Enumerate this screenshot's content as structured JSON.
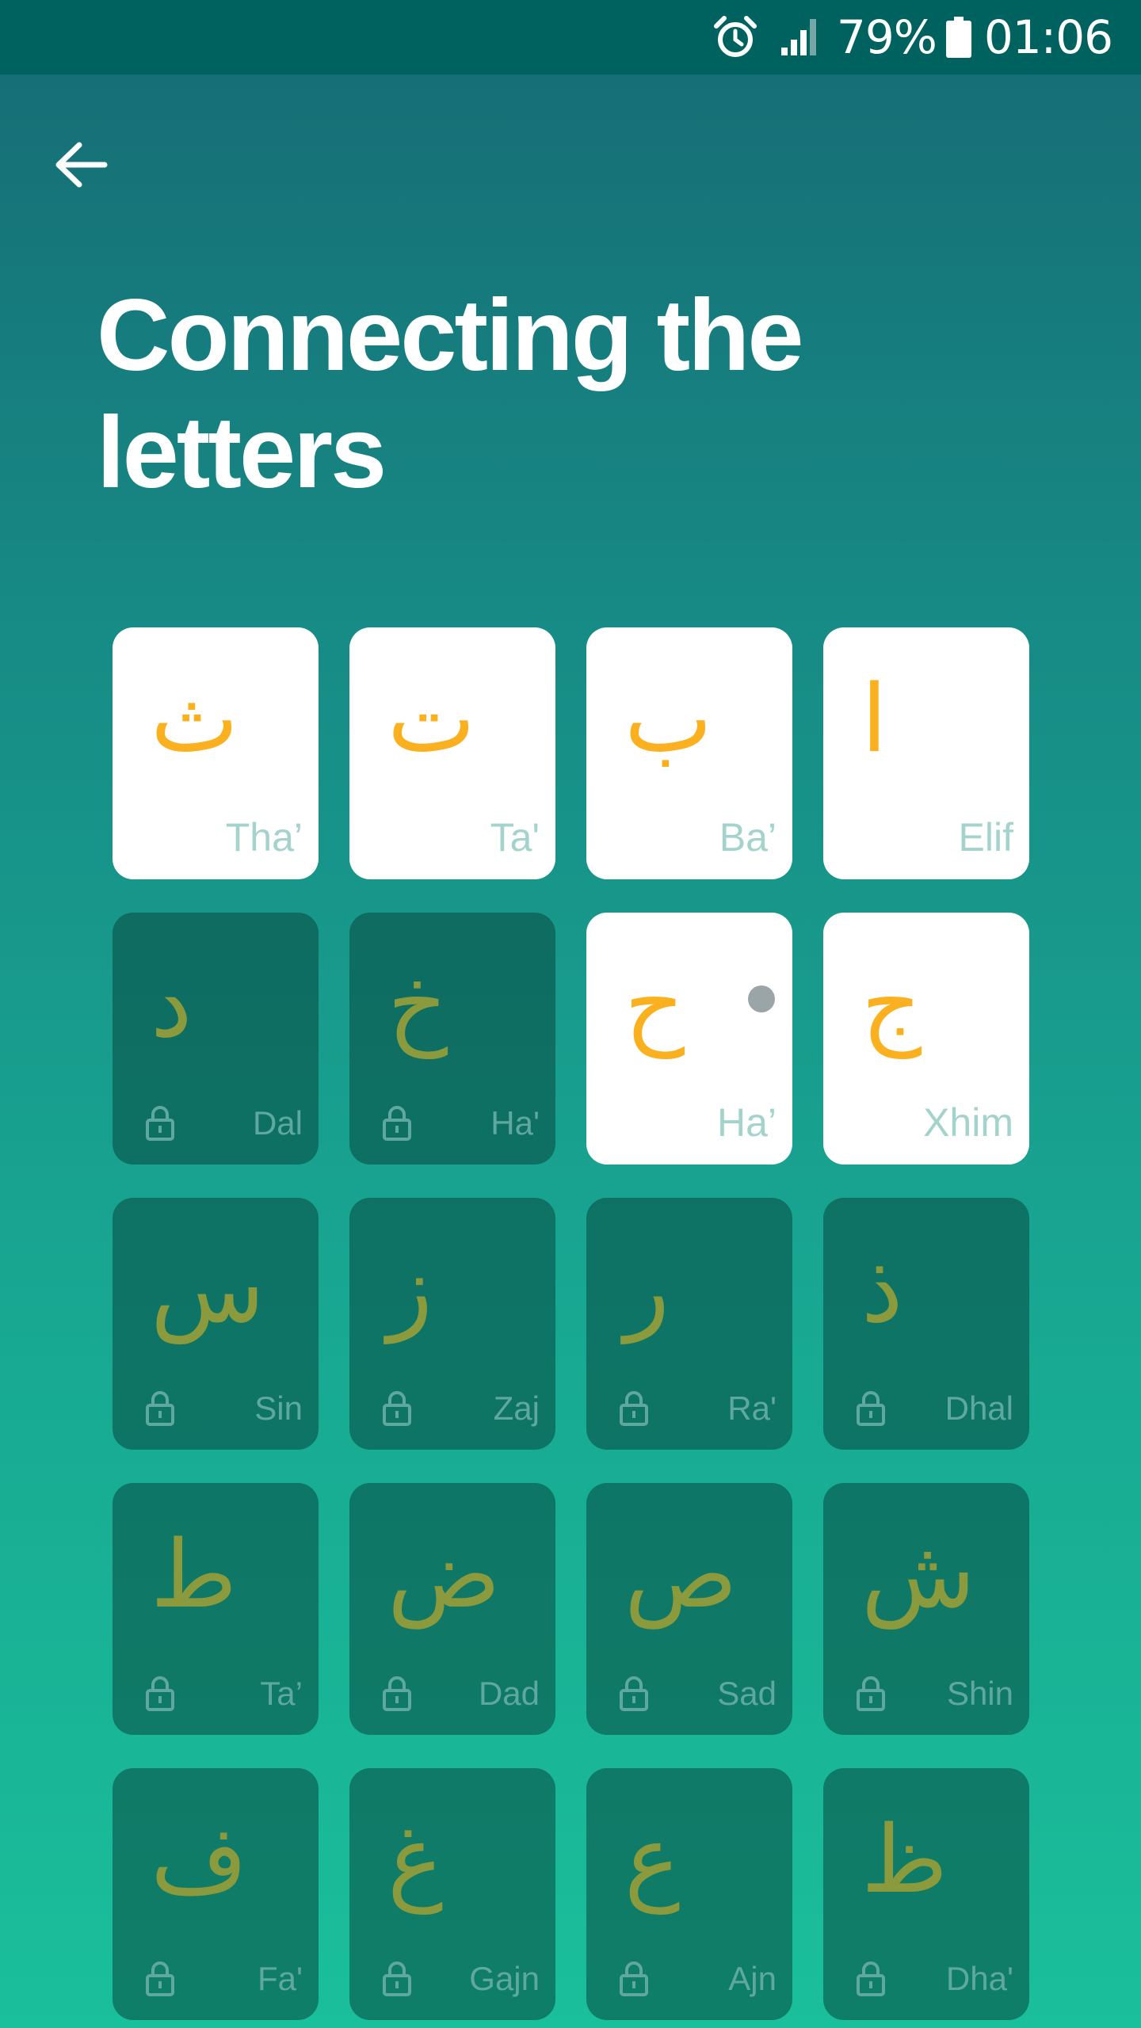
{
  "status_bar": {
    "battery_percent": "79%",
    "time": "01:06",
    "icons": [
      "alarm-icon",
      "signal-icon",
      "battery-icon"
    ]
  },
  "header": {
    "back_icon": "arrow-left-icon",
    "title": "Connecting the letters"
  },
  "colors": {
    "status_bar": "#00625f",
    "gradient_top": "#166b74",
    "gradient_bottom": "#1abf9b",
    "glyph_unlocked": "#fbb11f",
    "glyph_locked": "#8b9a3c",
    "name_unlocked": "#a3d3cb",
    "name_locked": "#5fa8a0",
    "new_dot": "#9ba4a6"
  },
  "letters": [
    {
      "glyph": "ث",
      "name": "Tha’",
      "locked": false
    },
    {
      "glyph": "ت",
      "name": "Ta'",
      "locked": false
    },
    {
      "glyph": "ب",
      "name": "Ba’",
      "locked": false
    },
    {
      "glyph": "ا",
      "name": "Elif",
      "locked": false
    },
    {
      "glyph": "د",
      "name": "Dal",
      "locked": true
    },
    {
      "glyph": "خ",
      "name": "Ha'",
      "locked": true
    },
    {
      "glyph": "ح",
      "name": "Ha’",
      "locked": false,
      "new": true
    },
    {
      "glyph": "ج",
      "name": "Xhim",
      "locked": false
    },
    {
      "glyph": "س",
      "name": "Sin",
      "locked": true
    },
    {
      "glyph": "ز",
      "name": "Zaj",
      "locked": true
    },
    {
      "glyph": "ر",
      "name": "Ra'",
      "locked": true
    },
    {
      "glyph": "ذ",
      "name": "Dhal",
      "locked": true
    },
    {
      "glyph": "ط",
      "name": "Ta’",
      "locked": true
    },
    {
      "glyph": "ض",
      "name": "Dad",
      "locked": true
    },
    {
      "glyph": "ص",
      "name": "Sad",
      "locked": true
    },
    {
      "glyph": "ش",
      "name": "Shin",
      "locked": true
    },
    {
      "glyph": "ف",
      "name": "Fa'",
      "locked": true
    },
    {
      "glyph": "غ",
      "name": "Gajn",
      "locked": true
    },
    {
      "glyph": "ع",
      "name": "Ajn",
      "locked": true
    },
    {
      "glyph": "ظ",
      "name": "Dha'",
      "locked": true
    }
  ]
}
